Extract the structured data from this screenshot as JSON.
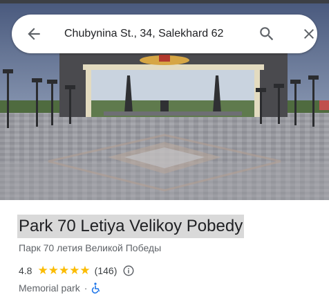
{
  "search": {
    "value": "Chubynina St., 34, Salekhard 62"
  },
  "place": {
    "title": "Park 70 Letiya Velikoy Pobedy",
    "local_name": "Парк 70 летия Великой Победы",
    "rating": "4.8",
    "stars": "★★★★★",
    "review_count": "(146)",
    "category": "Memorial park",
    "separator": "·"
  },
  "icons": {
    "back": "arrow-back-icon",
    "search": "search-icon",
    "close": "close-icon",
    "info": "info-icon",
    "accessibility": "wheelchair-icon"
  },
  "colors": {
    "star": "#fbbc04",
    "accessibility": "#1a73e8",
    "title_highlight": "#d9d9d9"
  }
}
